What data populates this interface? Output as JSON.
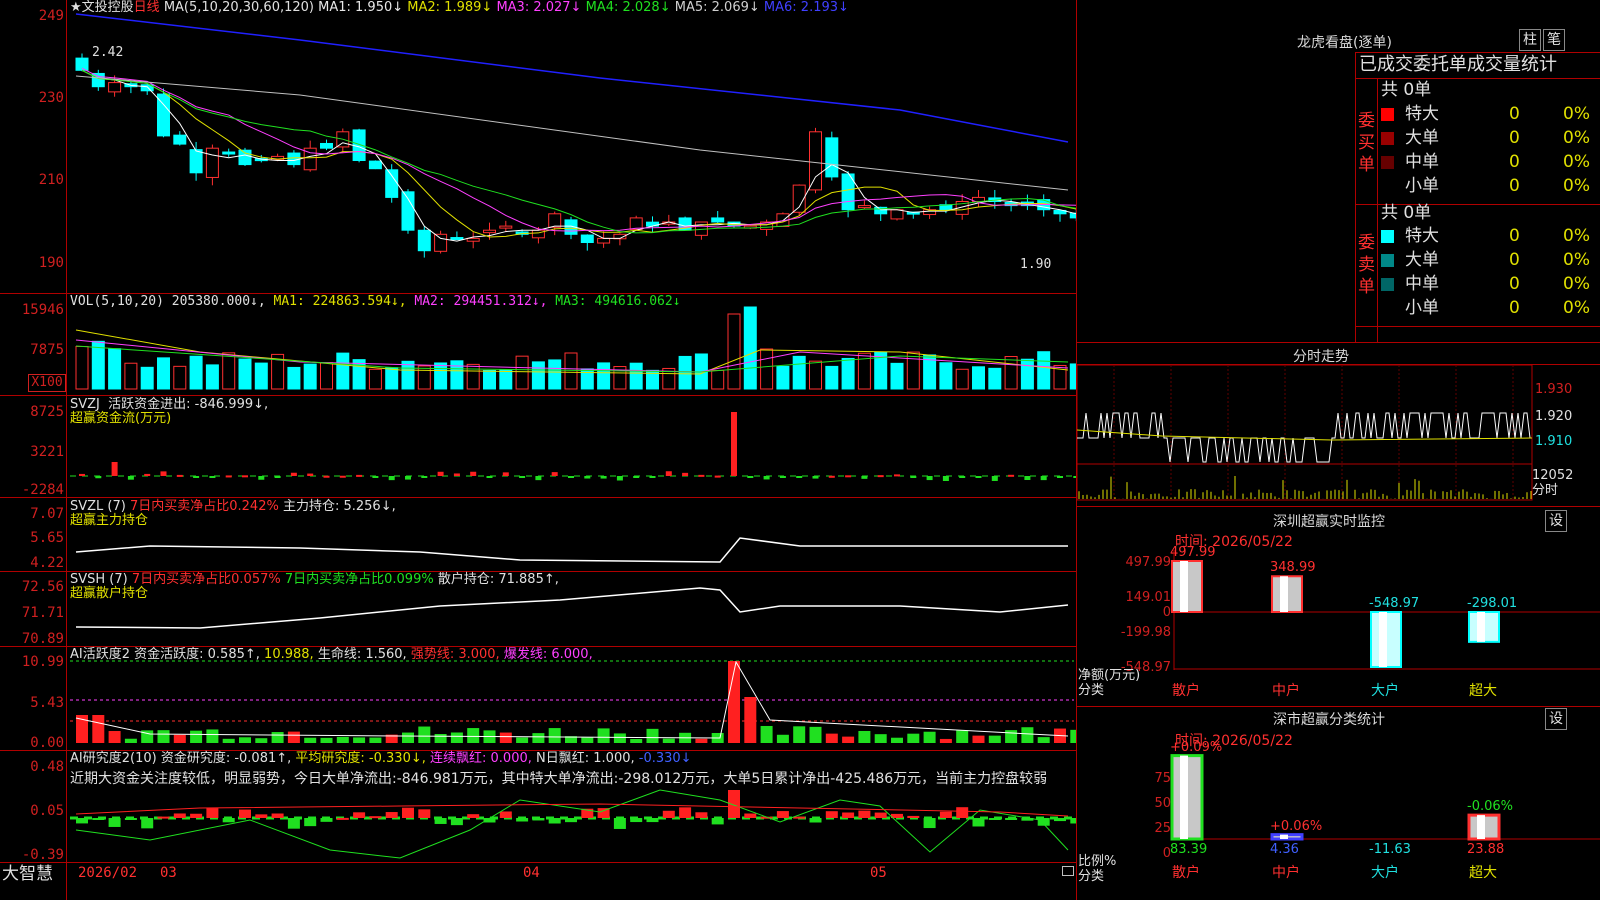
{
  "stock": {
    "name": "★文投控股",
    "period": "日线",
    "ma_label": "MA(5,10,20,30,60,120)",
    "ma1": "MA1: 1.950↓",
    "ma2": "MA2: 1.989↓",
    "ma3": "MA3: 2.027↓",
    "ma4": "MA4: 2.028↓",
    "ma5": "MA5: 2.069↓",
    "ma6": "MA6: 2.193↓",
    "high_marker": "2.42",
    "low_marker": "1.90"
  },
  "price_axis": [
    "249",
    "230",
    "210",
    "190"
  ],
  "vol": {
    "label": "VOL(5,10,20)",
    "value": "205380.000↓,",
    "ma1": "MA1: 224863.594↓,",
    "ma2": "MA2: 294451.312↓,",
    "ma3": "MA3: 494616.062↓",
    "axis": [
      "15946",
      "7875"
    ],
    "unit": "X100"
  },
  "svzj": {
    "label": "SVZJ",
    "desc": "活跃资金进出: -846.999↓,",
    "title": "超赢资金流(万元)",
    "axis": [
      "8725",
      "3221",
      "-2284"
    ]
  },
  "svzl": {
    "label": "SVZL (7)",
    "ratio": "7日内买卖净占比0.242%",
    "hold": "主力持仓: 5.256↓,",
    "title": "超赢主力持仓",
    "axis": [
      "7.07",
      "5.65",
      "4.22"
    ]
  },
  "svsh": {
    "label": "SVSH (7)",
    "ratio1": "7日内买卖净占比0.057%",
    "ratio2": "7日内买卖净占比0.099%",
    "hold": "散户持仓: 71.885↑,",
    "title": "超赢散户持仓",
    "axis": [
      "72.56",
      "71.71",
      "70.89"
    ]
  },
  "ai_active": {
    "label": "AI活跃度2",
    "fund": "资金活跃度: 0.585↑,",
    "v2": "10.988,",
    "life": "生命线: 1.560,",
    "strong": "强势线: 3.000,",
    "burst": "爆发线: 6.000,",
    "axis": [
      "10.99",
      "5.43",
      "0.00"
    ]
  },
  "ai_research": {
    "label": "AI研究度2(10)",
    "fund": "资金研究度: -0.081↑,",
    "avg": "平均研究度: -0.330↓,",
    "cont": "连续飘红: 0.000,",
    "nday": "N日飘红: 1.000,",
    "last": "-0.330↓",
    "comment": "近期大资金关注度较低，明显弱势，今日大单净流出:-846.981万元，其中特大单净流出:-298.012万元，大单5日累计净出-425.486万元，当前主力控盘较弱",
    "axis": [
      "0.48",
      "0.05",
      "-0.39"
    ]
  },
  "bottom": {
    "brand": "大智慧",
    "dates": [
      "2026/02",
      "03",
      "04",
      "05"
    ]
  },
  "dragon": {
    "title": "龙虎看盘(逐单)",
    "btn1": "柱",
    "btn2": "笔",
    "subtitle": "已成交委托单成交量统计",
    "buy_label": "委买单",
    "sell_label": "委卖单",
    "buy_total": "共 0单",
    "sell_total": "共 0单",
    "rows": [
      {
        "name": "特大",
        "num": "0",
        "pct": "0%"
      },
      {
        "name": "大单",
        "num": "0",
        "pct": "0%"
      },
      {
        "name": "中单",
        "num": "0",
        "pct": "0%"
      },
      {
        "name": "小单",
        "num": "0",
        "pct": "0%"
      }
    ],
    "buy_colors": [
      "#ff0000",
      "#990000",
      "#660000",
      "#000000"
    ],
    "sell_colors": [
      "#00ffff",
      "#008888",
      "#006666",
      "#000000"
    ]
  },
  "intraday": {
    "title": "分时走势",
    "axis": [
      "1.930",
      "1.920",
      "1.910"
    ],
    "vol_axis": "12052",
    "vol_unit": "分时"
  },
  "monitor": {
    "title": "深圳超赢实时监控",
    "btn": "设",
    "time": "时间: 2026/05/22",
    "axis": [
      "497.99",
      "149.01",
      "0",
      "-199.98",
      "-548.97"
    ],
    "axis_caption1": "净额(万元)",
    "axis_caption2": "分类",
    "categories": [
      "散户",
      "中户",
      "大户",
      "超大"
    ],
    "values": [
      497.99,
      348.99,
      -548.97,
      -298.01
    ],
    "labels": [
      "497.99",
      "348.99",
      "-548.97",
      "-298.01"
    ]
  },
  "classify": {
    "title": "深市超赢分类统计",
    "btn": "设",
    "time": "时间: 2026/05/22",
    "axis": [
      "75",
      "50",
      "25",
      "0"
    ],
    "axis_caption1": "比例%",
    "axis_caption2": "分类",
    "categories": [
      "散户",
      "中户",
      "大户",
      "超大"
    ],
    "pct_labels": [
      "+0.09%",
      "+0.06%",
      "",
      "-0.06%"
    ],
    "values": [
      83.39,
      4.36,
      -11.63,
      23.88
    ],
    "value_labels": [
      "83.39",
      "4.36",
      "-11.63",
      "23.88"
    ]
  },
  "chart_data": {
    "type": "bar",
    "title": "深圳超赢实时监控",
    "categories": [
      "散户",
      "中户",
      "大户",
      "超大"
    ],
    "series": [
      {
        "values": [
          497.99,
          348.99,
          -548.97,
          -298.01
        ]
      }
    ],
    "ylabel": "净额(万元)",
    "xlabel": "分类",
    "ylim": [
      -548.97,
      497.99
    ]
  }
}
